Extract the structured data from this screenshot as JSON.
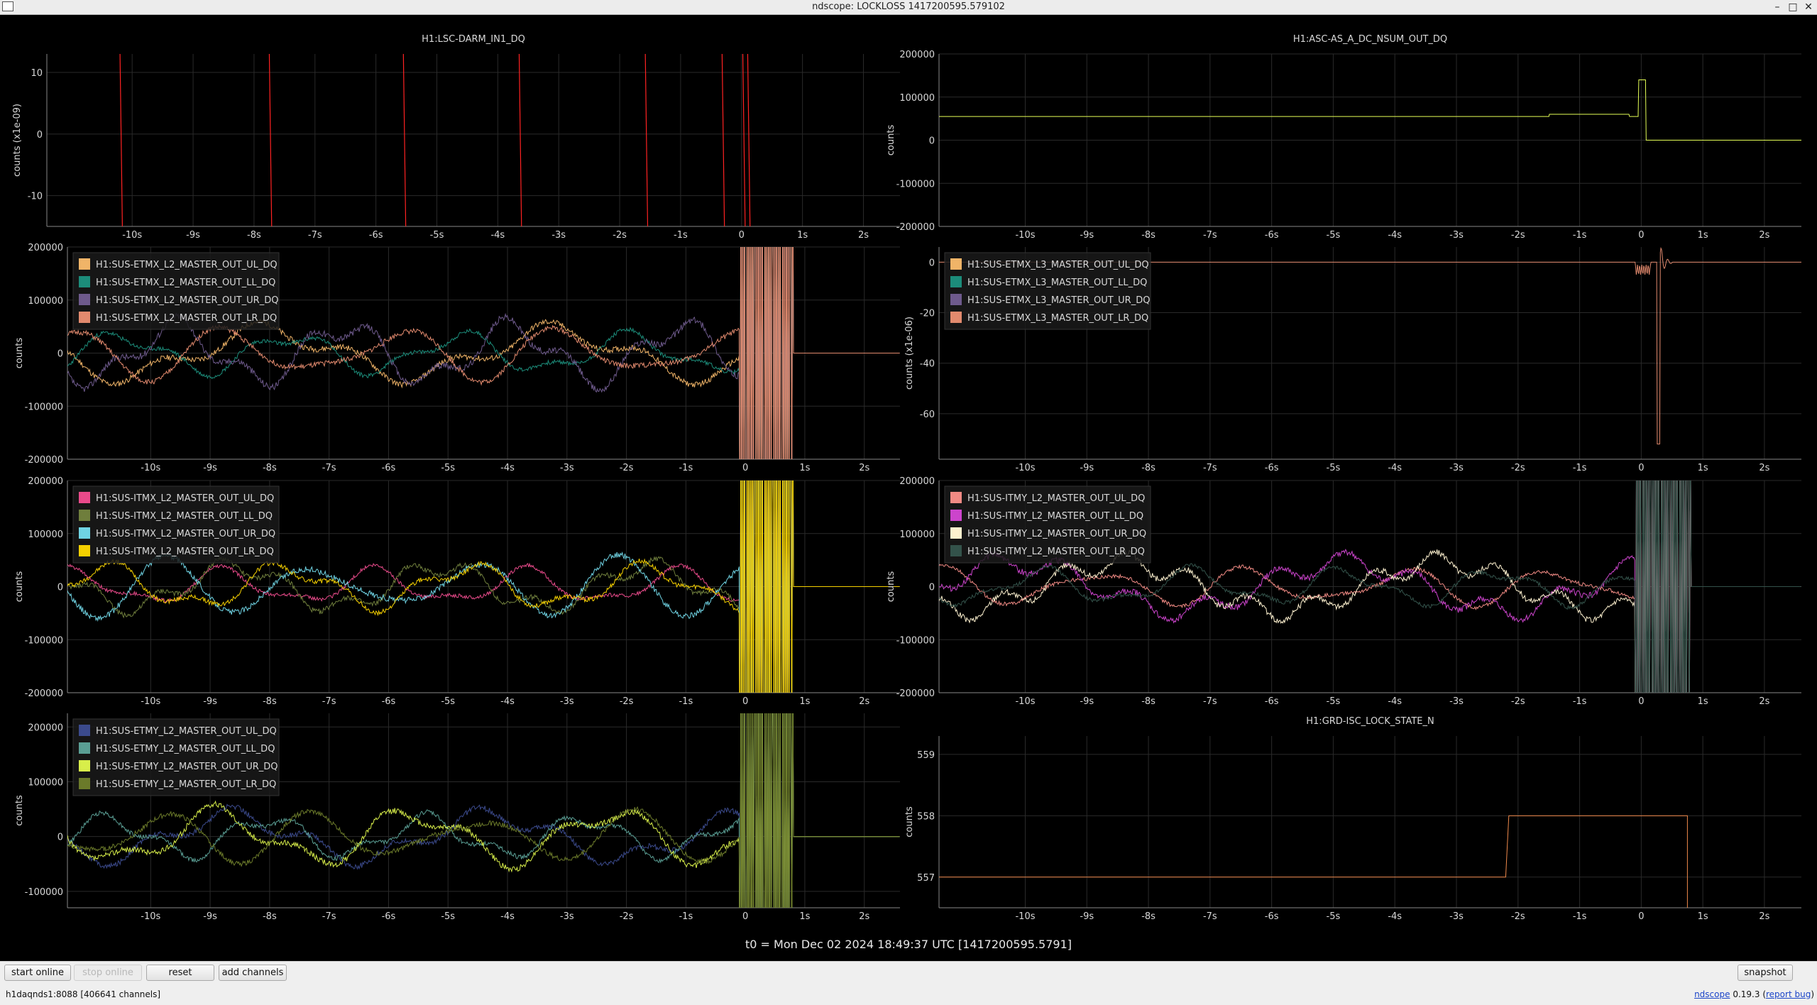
{
  "window": {
    "title": "ndscope: LOCKLOSS 1417200595.579102",
    "buttons": {
      "minimize": "–",
      "maximize": "□",
      "close": "✕"
    }
  },
  "time_axis": {
    "unit": "s",
    "range": [
      -11.4,
      2.6
    ],
    "ticks": [
      "-10s",
      "-9s",
      "-8s",
      "-7s",
      "-6s",
      "-5s",
      "-4s",
      "-3s",
      "-2s",
      "-1s",
      "0",
      "1s",
      "2s"
    ],
    "tick_values": [
      -10,
      -9,
      -8,
      -7,
      -6,
      -5,
      -4,
      -3,
      -2,
      -1,
      0,
      1,
      2
    ]
  },
  "t0_label": "t0 = Mon Dec 02 2024 18:49:37 UTC [1417200595.5791]",
  "colors": {
    "background": "#000000",
    "grid": "#2a2a2a",
    "axis_text": "#d8d8d8",
    "legend_bg": "#1a1a1a"
  },
  "plots": [
    {
      "id": "darm",
      "title": "H1:LSC-DARM_IN1_DQ",
      "ylabel": "counts (x1e-09)",
      "ylim": [
        -15,
        13
      ],
      "yticks": [
        10,
        0,
        -10
      ],
      "ytick_labels": [
        "10",
        "0",
        "-10"
      ],
      "legend": [],
      "traces": [
        {
          "color": "#ff2222",
          "kind": "spikes",
          "x": [
            -10.2,
            -7.75,
            -5.55,
            -3.65,
            -1.58,
            -0.32,
            0.02,
            0.1
          ]
        }
      ]
    },
    {
      "id": "asc",
      "title": "H1:ASC-AS_A_DC_NSUM_OUT_DQ",
      "ylabel": "counts",
      "ylim": [
        -200000,
        200000
      ],
      "yticks": [
        200000,
        100000,
        0,
        -100000,
        -200000
      ],
      "ytick_labels": [
        "200000",
        "100000",
        "0",
        "-100000",
        "-200000"
      ],
      "legend": [],
      "traces": [
        {
          "color": "#e5ff56",
          "kind": "asc"
        }
      ]
    },
    {
      "id": "etmx_l2",
      "title": "",
      "ylabel": "counts",
      "ylim": [
        -200000,
        200000
      ],
      "yticks": [
        200000,
        100000,
        0,
        -100000,
        -200000
      ],
      "ytick_labels": [
        "200000",
        "100000",
        "0",
        "-100000",
        "-200000"
      ],
      "legend": [
        {
          "label": "H1:SUS-ETMX_L2_MASTER_OUT_UL_DQ",
          "color": "#f0b468"
        },
        {
          "label": "H1:SUS-ETMX_L2_MASTER_OUT_LL_DQ",
          "color": "#1c8c7a"
        },
        {
          "label": "H1:SUS-ETMX_L2_MASTER_OUT_UR_DQ",
          "color": "#6e5a8c"
        },
        {
          "label": "H1:SUS-ETMX_L2_MASTER_OUT_LR_DQ",
          "color": "#e28a6e"
        }
      ],
      "traces": [
        {
          "color": "#f0b468",
          "kind": "wander",
          "seed": 11,
          "amp": 60000,
          "burst_end": 0.8
        },
        {
          "color": "#1c8c7a",
          "kind": "wander",
          "seed": 23,
          "amp": 45000,
          "burst_end": 0.8
        },
        {
          "color": "#6e5a8c",
          "kind": "wander",
          "seed": 37,
          "amp": 70000,
          "burst_end": 0.8
        },
        {
          "color": "#e28a6e",
          "kind": "wander",
          "seed": 51,
          "amp": 55000,
          "burst_end": 0.8
        }
      ]
    },
    {
      "id": "etmx_l3",
      "title": "",
      "ylabel": "counts (x1e-06)",
      "ylim": [
        -78,
        6
      ],
      "yticks": [
        0,
        -20,
        -40,
        -60
      ],
      "ytick_labels": [
        "0",
        "-20",
        "-40",
        "-60"
      ],
      "legend": [
        {
          "label": "H1:SUS-ETMX_L3_MASTER_OUT_UL_DQ",
          "color": "#f0b468"
        },
        {
          "label": "H1:SUS-ETMX_L3_MASTER_OUT_LL_DQ",
          "color": "#1c8c7a"
        },
        {
          "label": "H1:SUS-ETMX_L3_MASTER_OUT_UR_DQ",
          "color": "#6e5a8c"
        },
        {
          "label": "H1:SUS-ETMX_L3_MASTER_OUT_LR_DQ",
          "color": "#e28a6e"
        }
      ],
      "traces": [
        {
          "color": "#e28a6e",
          "kind": "l3"
        }
      ]
    },
    {
      "id": "itmx_l2",
      "title": "",
      "ylabel": "counts",
      "ylim": [
        -200000,
        200000
      ],
      "yticks": [
        200000,
        100000,
        0,
        -100000,
        -200000
      ],
      "ytick_labels": [
        "200000",
        "100000",
        "0",
        "-100000",
        "-200000"
      ],
      "legend": [
        {
          "label": "H1:SUS-ITMX_L2_MASTER_OUT_UL_DQ",
          "color": "#e84a8a"
        },
        {
          "label": "H1:SUS-ITMX_L2_MASTER_OUT_LL_DQ",
          "color": "#6f7e3c"
        },
        {
          "label": "H1:SUS-ITMX_L2_MASTER_OUT_UR_DQ",
          "color": "#6fd3e3"
        },
        {
          "label": "H1:SUS-ITMX_L2_MASTER_OUT_LR_DQ",
          "color": "#f5d000"
        }
      ],
      "traces": [
        {
          "color": "#e84a8a",
          "kind": "wander",
          "seed": 61,
          "amp": 40000,
          "burst_end": 0.8
        },
        {
          "color": "#6f7e3c",
          "kind": "wander",
          "seed": 73,
          "amp": 55000,
          "burst_end": 0.8
        },
        {
          "color": "#6fd3e3",
          "kind": "wander",
          "seed": 89,
          "amp": 60000,
          "burst_end": 0.8
        },
        {
          "color": "#f5d000",
          "kind": "wander",
          "seed": 97,
          "amp": 50000,
          "burst_end": 0.8
        }
      ]
    },
    {
      "id": "itmy_l2",
      "title": "",
      "ylabel": "counts",
      "ylim": [
        -200000,
        200000
      ],
      "yticks": [
        200000,
        100000,
        0,
        -100000,
        -200000
      ],
      "ytick_labels": [
        "200000",
        "100000",
        "0",
        "-100000",
        "-200000"
      ],
      "legend": [
        {
          "label": "H1:SUS-ITMY_L2_MASTER_OUT_UL_DQ",
          "color": "#f08a84"
        },
        {
          "label": "H1:SUS-ITMY_L2_MASTER_OUT_LL_DQ",
          "color": "#cc44cc"
        },
        {
          "label": "H1:SUS-ITMY_L2_MASTER_OUT_UR_DQ",
          "color": "#fdf1cf"
        },
        {
          "label": "H1:SUS-ITMY_L2_MASTER_OUT_LR_DQ",
          "color": "#33524a"
        }
      ],
      "traces": [
        {
          "color": "#f08a84",
          "kind": "wander",
          "seed": 103,
          "amp": 40000,
          "burst_end": 0.8
        },
        {
          "color": "#cc44cc",
          "kind": "wander",
          "seed": 113,
          "amp": 65000,
          "burst_end": 0.8
        },
        {
          "color": "#fdf1cf",
          "kind": "wander",
          "seed": 127,
          "amp": 65000,
          "burst_end": 0.8
        },
        {
          "color": "#33524a",
          "kind": "wander",
          "seed": 131,
          "amp": 40000,
          "burst_end": 0.8
        }
      ]
    },
    {
      "id": "etmy_l2",
      "title": "",
      "ylabel": "counts",
      "ylim": [
        -130000,
        225000
      ],
      "yticks": [
        200000,
        100000,
        0,
        -100000
      ],
      "ytick_labels": [
        "200000",
        "100000",
        "0",
        "-100000"
      ],
      "legend": [
        {
          "label": "H1:SUS-ETMY_L2_MASTER_OUT_UL_DQ",
          "color": "#3b4a8c"
        },
        {
          "label": "H1:SUS-ETMY_L2_MASTER_OUT_LL_DQ",
          "color": "#5a9e94"
        },
        {
          "label": "H1:SUS-ETMY_L2_MASTER_OUT_UR_DQ",
          "color": "#d8ee4a"
        },
        {
          "label": "H1:SUS-ETMY_L2_MASTER_OUT_LR_DQ",
          "color": "#6b7a2a"
        }
      ],
      "traces": [
        {
          "color": "#3b4a8c",
          "kind": "wander",
          "seed": 137,
          "amp": 55000,
          "burst_end": 0.8
        },
        {
          "color": "#5a9e94",
          "kind": "wander",
          "seed": 149,
          "amp": 45000,
          "burst_end": 0.8
        },
        {
          "color": "#d8ee4a",
          "kind": "wander",
          "seed": 157,
          "amp": 60000,
          "burst_end": 0.8
        },
        {
          "color": "#6b7a2a",
          "kind": "wander",
          "seed": 163,
          "amp": 50000,
          "burst_end": 0.8
        }
      ]
    },
    {
      "id": "guardian",
      "title": "H1:GRD-ISC_LOCK_STATE_N",
      "ylabel": "counts",
      "ylim": [
        556.5,
        559.3
      ],
      "yticks": [
        559,
        558,
        557
      ],
      "ytick_labels": [
        "559",
        "558",
        "557"
      ],
      "legend": [],
      "traces": [
        {
          "color": "#f08a4c",
          "kind": "step",
          "points": [
            [
              -11.4,
              557
            ],
            [
              -2.2,
              557
            ],
            [
              -2.15,
              558
            ],
            [
              0.75,
              558
            ],
            [
              0.75,
              556.5
            ]
          ]
        }
      ]
    }
  ],
  "toolbar": {
    "start_online": "start online",
    "stop_online": "stop online",
    "reset": "reset",
    "add_channels": "add channels",
    "snapshot": "snapshot"
  },
  "status": {
    "server": "h1daqnds1:8088  [406641 channels]",
    "version_name": "ndscope",
    "version_number": "0.19.3",
    "report_bug": "report bug"
  }
}
